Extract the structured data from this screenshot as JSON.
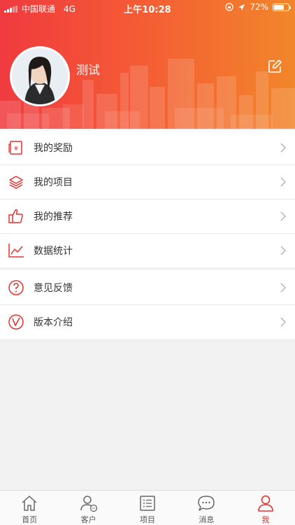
{
  "status_bar": {
    "carrier": "中国联通",
    "network": "4G",
    "time": "上午10:28",
    "battery_percent": "72%",
    "battery_level": 0.72
  },
  "profile": {
    "name": "测试",
    "edit_icon": "edit-icon"
  },
  "menu_group_1": [
    {
      "label": "我的奖励",
      "icon": "reward-receipt-icon"
    },
    {
      "label": "我的项目",
      "icon": "layers-icon"
    },
    {
      "label": "我的推荐",
      "icon": "thumbs-up-icon"
    },
    {
      "label": "数据统计",
      "icon": "line-chart-icon"
    }
  ],
  "menu_group_2": [
    {
      "label": "意见反馈",
      "icon": "question-icon"
    },
    {
      "label": "版本介绍",
      "icon": "version-v-icon"
    }
  ],
  "tabbar": [
    {
      "label": "首页",
      "icon": "home-icon",
      "active": false
    },
    {
      "label": "客户",
      "icon": "customers-icon",
      "active": false
    },
    {
      "label": "项目",
      "icon": "list-icon",
      "active": false
    },
    {
      "label": "消息",
      "icon": "message-icon",
      "active": false
    },
    {
      "label": "我",
      "icon": "person-icon",
      "active": true
    }
  ],
  "colors": {
    "accent": "#e8312f",
    "header_gradient_start": "#f03a3f",
    "header_gradient_end": "#f2862a"
  }
}
